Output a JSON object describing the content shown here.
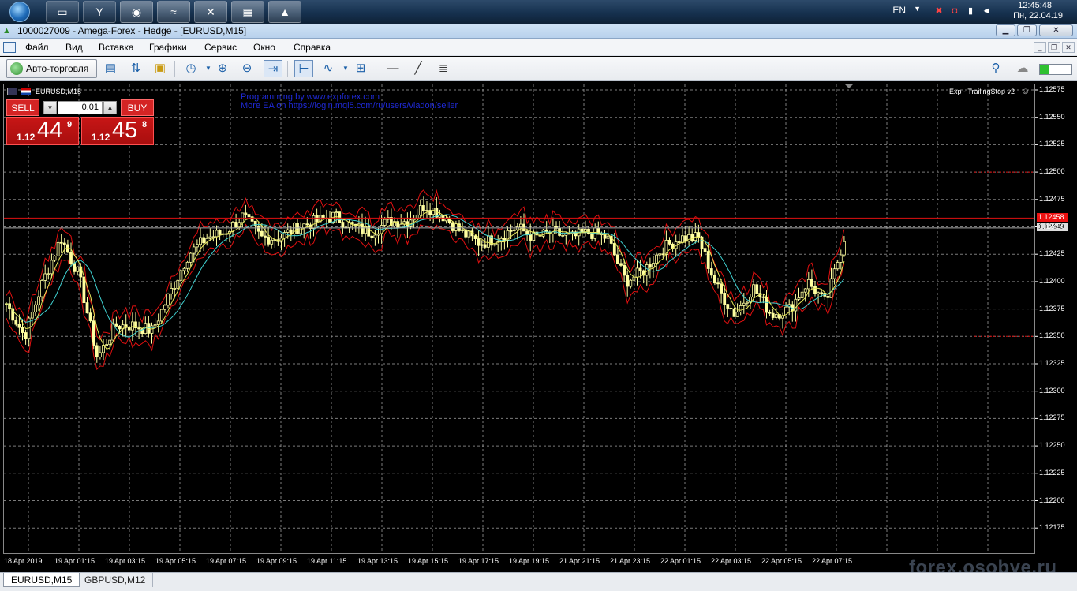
{
  "taskbar": {
    "language": "EN",
    "clock_time": "12:45:48",
    "clock_date": "Пн, 22.04.19",
    "apps": [
      "folder",
      "yandex-browser",
      "chrome",
      "metatrader",
      "metatrader-x",
      "metatrader-blue",
      "metatrader-green"
    ]
  },
  "window": {
    "title": "1000027009 - Amega-Forex - Hedge - [EURUSD,M15]"
  },
  "menu": {
    "items": [
      "Файл",
      "Вид",
      "Вставка",
      "Графики",
      "Сервис",
      "Окно",
      "Справка"
    ]
  },
  "toolbar": {
    "autotrade_label": "Авто-торговля"
  },
  "chart": {
    "symbol_label": "EURUSD,M15",
    "ea_text_1": "Programming by www.expforex.com",
    "ea_text_2": "More EA on https://login.mql5.com/ru/users/vladon/seller",
    "ea_name": "Exp - TrailingStop v2",
    "bid_tag": "1.12458",
    "current_tag": "1.12449",
    "price_labels": [
      "1.12575",
      "1.12550",
      "1.12525",
      "1.12500",
      "1.12475",
      "1.12450",
      "1.12425",
      "1.12400",
      "1.12375",
      "1.12350",
      "1.12325",
      "1.12300",
      "1.12275",
      "1.12250",
      "1.12225",
      "1.12200",
      "1.12175"
    ],
    "time_labels": [
      "18 Apr 2019",
      "19 Apr 01:15",
      "19 Apr 03:15",
      "19 Apr 05:15",
      "19 Apr 07:15",
      "19 Apr 09:15",
      "19 Apr 11:15",
      "19 Apr 13:15",
      "19 Apr 15:15",
      "19 Apr 17:15",
      "19 Apr 19:15",
      "21 Apr 21:15",
      "21 Apr 23:15",
      "22 Apr 01:15",
      "22 Apr 03:15",
      "22 Apr 05:15",
      "22 Apr 07:15"
    ]
  },
  "one_click": {
    "sell_label": "SELL",
    "buy_label": "BUY",
    "lot": "0.01",
    "sell_prefix": "1.12",
    "sell_big": "44",
    "sell_sup": "9",
    "buy_prefix": "1.12",
    "buy_big": "45",
    "buy_sup": "8"
  },
  "watermark": "forex.osobye.ru",
  "tabs": [
    "EURUSD,M15",
    "GBPUSD,M12"
  ],
  "colors": {
    "candle_up": "#000000",
    "candle_body": "#ffffa0",
    "ma_fast": "#e8e85a",
    "ma_slow": "#3fd0d0",
    "envelope": "#e01010",
    "bid_line": "#e01010",
    "grid": "#b0b0b0"
  },
  "chart_data": {
    "type": "candlestick",
    "symbol": "EURUSD",
    "timeframe": "M15",
    "ylim": [
      1.1216,
      1.1259
    ],
    "grid": true,
    "bid": 1.12458,
    "current": 1.12449,
    "close_path": [
      1.1238,
      1.1235,
      1.124,
      1.1244,
      1.12405,
      1.1233,
      1.1236,
      1.1236,
      1.12355,
      1.1239,
      1.12425,
      1.1244,
      1.12445,
      1.1246,
      1.1244,
      1.1244,
      1.1245,
      1.12455,
      1.1246,
      1.1245,
      1.12445,
      1.12455,
      1.12455,
      1.1247,
      1.1246,
      1.12445,
      1.12435,
      1.1244,
      1.1245,
      1.1244,
      1.12445,
      1.1244,
      1.12445,
      1.1244,
      1.124,
      1.1241,
      1.1243,
      1.1244,
      1.1244,
      1.12395,
      1.1237,
      1.12395,
      1.1237,
      1.12375,
      1.124,
      1.1238,
      1.1244
    ]
  }
}
